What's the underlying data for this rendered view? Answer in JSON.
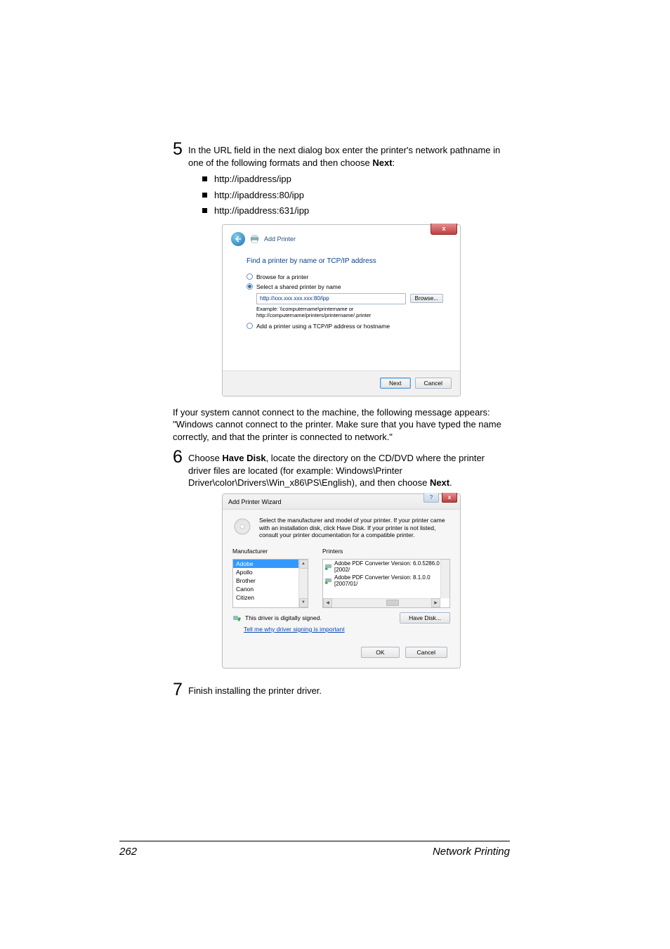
{
  "step5": {
    "num": "5",
    "text_a": "In the URL field in the next dialog box enter the printer's network pathname in one of the following formats and then choose ",
    "bold": "Next",
    "text_b": ":",
    "bullets": [
      "http://ipaddress/ipp",
      "http://ipaddress:80/ipp",
      "http://ipaddress:631/ipp"
    ]
  },
  "dlg1": {
    "close": "x",
    "breadcrumb": "Add Printer",
    "heading": "Find a printer by name or TCP/IP address",
    "r1": "Browse for a printer",
    "r2": "Select a shared printer by name",
    "url": "http://xxx.xxx.xxx.xxx:80/ipp",
    "browse": "Browse...",
    "ex1": "Example: \\\\computername\\printername or",
    "ex2": "http://computername/printers/printername/.printer",
    "r3": "Add a printer using a TCP/IP address or hostname",
    "next": "Next",
    "cancel": "Cancel"
  },
  "para_cannot": "If your system cannot connect to the machine, the following message appears: \"Windows cannot connect to the printer. Make sure that you have typed the name correctly, and that the printer is connected to network.\"",
  "step6": {
    "num": "6",
    "t1": "Choose ",
    "b1": "Have Disk",
    "t2": ", locate the directory on the CD/DVD where the printer driver files are located (for example: Windows\\Printer Driver\\color\\Drivers\\Win_x86\\PS\\English), and then choose ",
    "b2": "Next",
    "t3": "."
  },
  "dlg2": {
    "title": "Add Printer Wizard",
    "close": "x",
    "help": "?",
    "desc": "Select the manufacturer and model of your printer. If your printer came with an installation disk, click Have Disk. If your printer is not listed, consult your printer documentation for a compatible printer.",
    "col1": "Manufacturer",
    "col2": "Printers",
    "manu": [
      "Adobe",
      "Apollo",
      "Brother",
      "Canon",
      "Citizen"
    ],
    "printers": [
      "Adobe PDF Converter Version: 6.0.5286.0 [2002/",
      "Adobe PDF Converter Version: 8.1.0.0 [2007/01/"
    ],
    "signed": "This driver is digitally signed.",
    "link": "Tell me why driver signing is important",
    "havedisk": "Have Disk...",
    "ok": "OK",
    "cancel": "Cancel"
  },
  "step7": {
    "num": "7",
    "text": "Finish installing the printer driver."
  },
  "footer": {
    "page": "262",
    "title": "Network Printing"
  }
}
